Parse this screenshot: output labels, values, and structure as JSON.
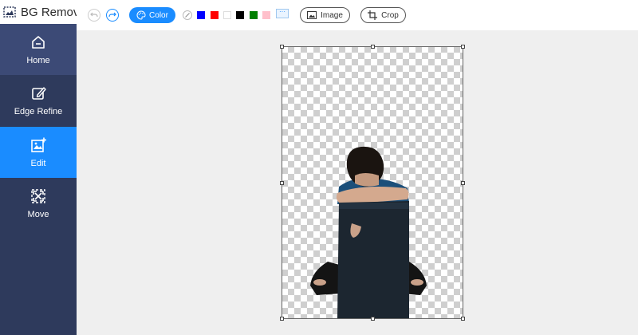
{
  "app": {
    "title": "BG Remover"
  },
  "sidebar": {
    "items": [
      {
        "label": "Home",
        "icon": "home-icon"
      },
      {
        "label": "Edge Refine",
        "icon": "edge-refine-icon"
      },
      {
        "label": "Edit",
        "icon": "edit-image-icon"
      },
      {
        "label": "Move",
        "icon": "move-icon"
      }
    ],
    "active": "Edit"
  },
  "toolbar": {
    "undo_icon": "undo-icon",
    "redo_icon": "redo-icon",
    "color_label": "Color",
    "swatches": [
      "none",
      "#0000ff",
      "#ff0000",
      "#ffffff",
      "#000000",
      "#008000",
      "#ffc0cb"
    ],
    "more_label": "···",
    "image_label": "Image",
    "crop_label": "Crop"
  },
  "colors": {
    "accent": "#1a8cff",
    "sidebar": "#2e3a5c",
    "sidebar_active": "#1a8cff",
    "sidebar_home": "#3c4a76"
  },
  "canvas": {
    "background": "transparent-checkerboard",
    "subject": "person-sitting-on-black-chair"
  }
}
